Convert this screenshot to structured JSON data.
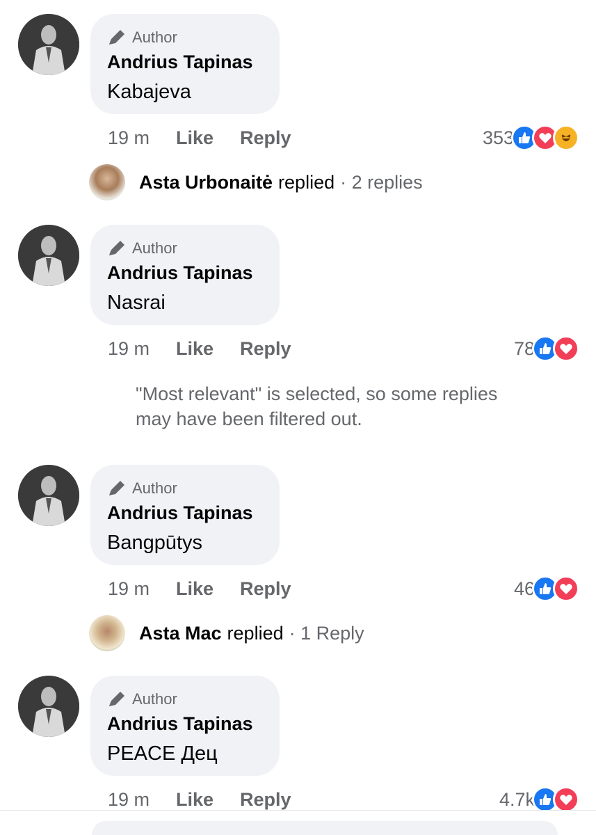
{
  "comments": [
    {
      "badge": "Author",
      "name": "Andrius Tapinas",
      "text": "Kabajeva",
      "time": "19 m",
      "like": "Like",
      "reply": "Reply",
      "reaction_count": "353",
      "reactions": [
        "like",
        "love",
        "haha"
      ]
    },
    {
      "badge": "Author",
      "name": "Andrius Tapinas",
      "text": "Nasrai",
      "time": "19 m",
      "like": "Like",
      "reply": "Reply",
      "reaction_count": "78",
      "reactions": [
        "like",
        "love"
      ]
    },
    {
      "badge": "Author",
      "name": "Andrius Tapinas",
      "text": "Bangpūtys",
      "time": "19 m",
      "like": "Like",
      "reply": "Reply",
      "reaction_count": "46",
      "reactions": [
        "like",
        "love"
      ]
    },
    {
      "badge": "Author",
      "name": "Andrius Tapinas",
      "text": "PEACE Дец",
      "time": "19 m",
      "like": "Like",
      "reply": "Reply",
      "reaction_count": "4.7k",
      "reactions": [
        "like",
        "love"
      ]
    }
  ],
  "replied": [
    {
      "name": "Asta Urbonaitė",
      "verb": "replied",
      "count": "· 2 replies"
    },
    {
      "name": "Asta Mac",
      "verb": "replied",
      "count": "· 1 Reply"
    }
  ],
  "filter_note": "\"Most relevant\" is selected, so some replies may have been filtered out.",
  "colors": {
    "like_blue": "#1877f2",
    "love_red": "#f33e58",
    "haha_yellow": "#f7b125",
    "bubble_bg": "#f0f2f5",
    "secondary_text": "#65676b"
  },
  "icons": {
    "author_badge": "pencil-icon",
    "like_reaction": "thumbs-up-icon",
    "love_reaction": "heart-icon",
    "haha_reaction": "laughing-face-icon"
  }
}
